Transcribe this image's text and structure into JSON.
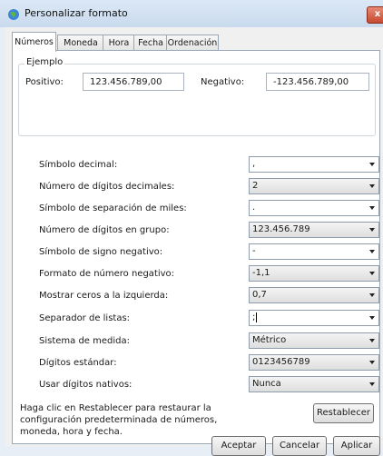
{
  "window": {
    "title": "Personalizar formato",
    "close_label": "x"
  },
  "tabs": [
    "Números",
    "Moneda",
    "Hora",
    "Fecha",
    "Ordenación"
  ],
  "example": {
    "legend": "Ejemplo",
    "positive_label": "Positivo:",
    "positive_value": "123.456.789,00",
    "negative_label": "Negativo:",
    "negative_value": "-123.456.789,00"
  },
  "settings": [
    {
      "label": "Símbolo decimal:",
      "value": ",",
      "style": "edit"
    },
    {
      "label": "Número de dígitos decimales:",
      "value": "2",
      "style": "btnlike"
    },
    {
      "label": "Símbolo de separación de miles:",
      "value": ".",
      "style": "edit"
    },
    {
      "label": "Número de dígitos en grupo:",
      "value": "123.456.789",
      "style": "btnlike"
    },
    {
      "label": "Símbolo de signo negativo:",
      "value": "-",
      "style": "edit"
    },
    {
      "label": "Formato de número negativo:",
      "value": "-1,1",
      "style": "btnlike"
    },
    {
      "label": "Mostrar ceros a la izquierda:",
      "value": "0,7",
      "style": "btnlike"
    },
    {
      "label": "Separador de listas:",
      "value": ";",
      "style": "edit"
    },
    {
      "label": "Sistema de medida:",
      "value": "Métrico",
      "style": "btnlike"
    },
    {
      "label": "Dígitos estándar:",
      "value": "0123456789",
      "style": "btnlike"
    },
    {
      "label": "Usar dígitos nativos:",
      "value": "Nunca",
      "style": "btnlike"
    }
  ],
  "help_text": "Haga clic en Restablecer para restaurar la configuración predeterminada de números, moneda, hora y fecha.",
  "buttons": {
    "reset": "Restablecer",
    "accept": "Aceptar",
    "cancel": "Cancelar",
    "apply": "Aplicar"
  }
}
